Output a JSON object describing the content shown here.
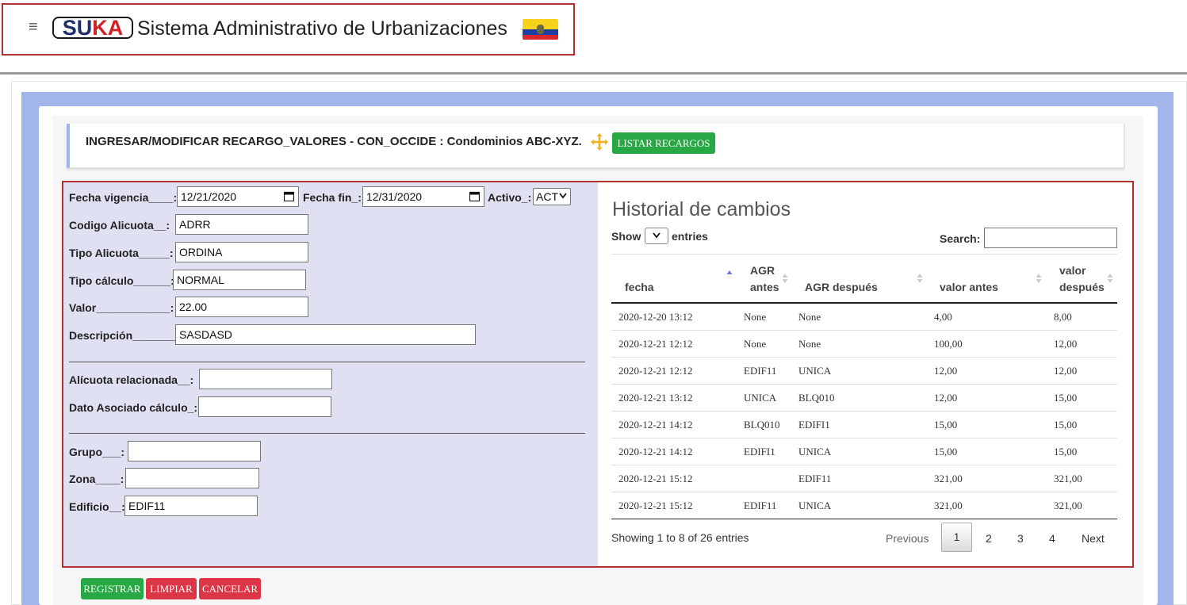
{
  "header": {
    "menu_icon": "hamburger-icon",
    "logo_part1": "SU",
    "logo_part2": "KA",
    "app_title": "Sistema Administrativo de Urbanizaciones",
    "flag_icon": "ecuador-flag-icon"
  },
  "page": {
    "title": "INGRESAR/MODIFICAR RECARGO_VALORES - CON_OCCIDE : Condominios ABC-XYZ.",
    "move_icon": "move-arrows-icon",
    "list_button": "LISTAR RECARGOS"
  },
  "form": {
    "fecha_vigencia_label": "Fecha vigencia____:",
    "fecha_vigencia_value": "12/21/2020",
    "fecha_fin_label": "Fecha fin_:",
    "fecha_fin_value": "12/31/2020",
    "activo_label": "Activo_:",
    "activo_value": "ACT",
    "codigo_label": "Codigo Alicuota__:",
    "codigo_value": "ADRR",
    "tipo_alicuota_label": "Tipo Alicuota_____:",
    "tipo_alicuota_value": "ORDINA",
    "tipo_calculo_label": "Tipo cálculo______:",
    "tipo_calculo_value": "NORMAL",
    "valor_label": "Valor____________:",
    "valor_value": "22.00",
    "descripcion_label": "Descripción_______:",
    "descripcion_value": "SASDASD",
    "alicuota_rel_label": "Alícuota relacionada__:",
    "alicuota_rel_value": "",
    "dato_asociado_label": "Dato Asociado cálculo_:",
    "dato_asociado_value": "",
    "grupo_label": "Grupo___:",
    "grupo_value": "",
    "zona_label": "Zona____:",
    "zona_value": "",
    "edificio_label": "Edificio__:",
    "edificio_value": "EDIF11"
  },
  "history": {
    "title": "Historial de cambios",
    "show_label": "Show",
    "entries_label": "entries",
    "search_label": "Search:",
    "columns": {
      "fecha": "fecha",
      "agr_antes_1": "AGR",
      "agr_antes_2": "antes",
      "agr_despues": "AGR después",
      "valor_antes": "valor antes",
      "valor_despues_1": "valor",
      "valor_despues_2": "después"
    },
    "rows": [
      [
        "2020-12-20 13:12",
        "None",
        "None",
        "4,00",
        "8,00"
      ],
      [
        "2020-12-21 12:12",
        "None",
        "None",
        "100,00",
        "12,00"
      ],
      [
        "2020-12-21 12:12",
        "EDIF11",
        "UNICA",
        "12,00",
        "12,00"
      ],
      [
        "2020-12-21 13:12",
        "UNICA",
        "BLQ010",
        "12,00",
        "15,00"
      ],
      [
        "2020-12-21 14:12",
        "BLQ010",
        "EDIFI1",
        "15,00",
        "15,00"
      ],
      [
        "2020-12-21 14:12",
        "EDIFI1",
        "UNICA",
        "15,00",
        "15,00"
      ],
      [
        "2020-12-21 15:12",
        "",
        "EDIF11",
        "321,00",
        "321,00"
      ],
      [
        "2020-12-21 15:12",
        "EDIF11",
        "UNICA",
        "321,00",
        "321,00"
      ]
    ],
    "info": "Showing 1 to 8 of 26 entries",
    "pagination": {
      "previous": "Previous",
      "pages": [
        "1",
        "2",
        "3",
        "4"
      ],
      "next": "Next"
    }
  },
  "actions": {
    "registrar": "REGISTRAR",
    "limpiar": "LIMPIAR",
    "cancelar": "CANCELAR"
  }
}
